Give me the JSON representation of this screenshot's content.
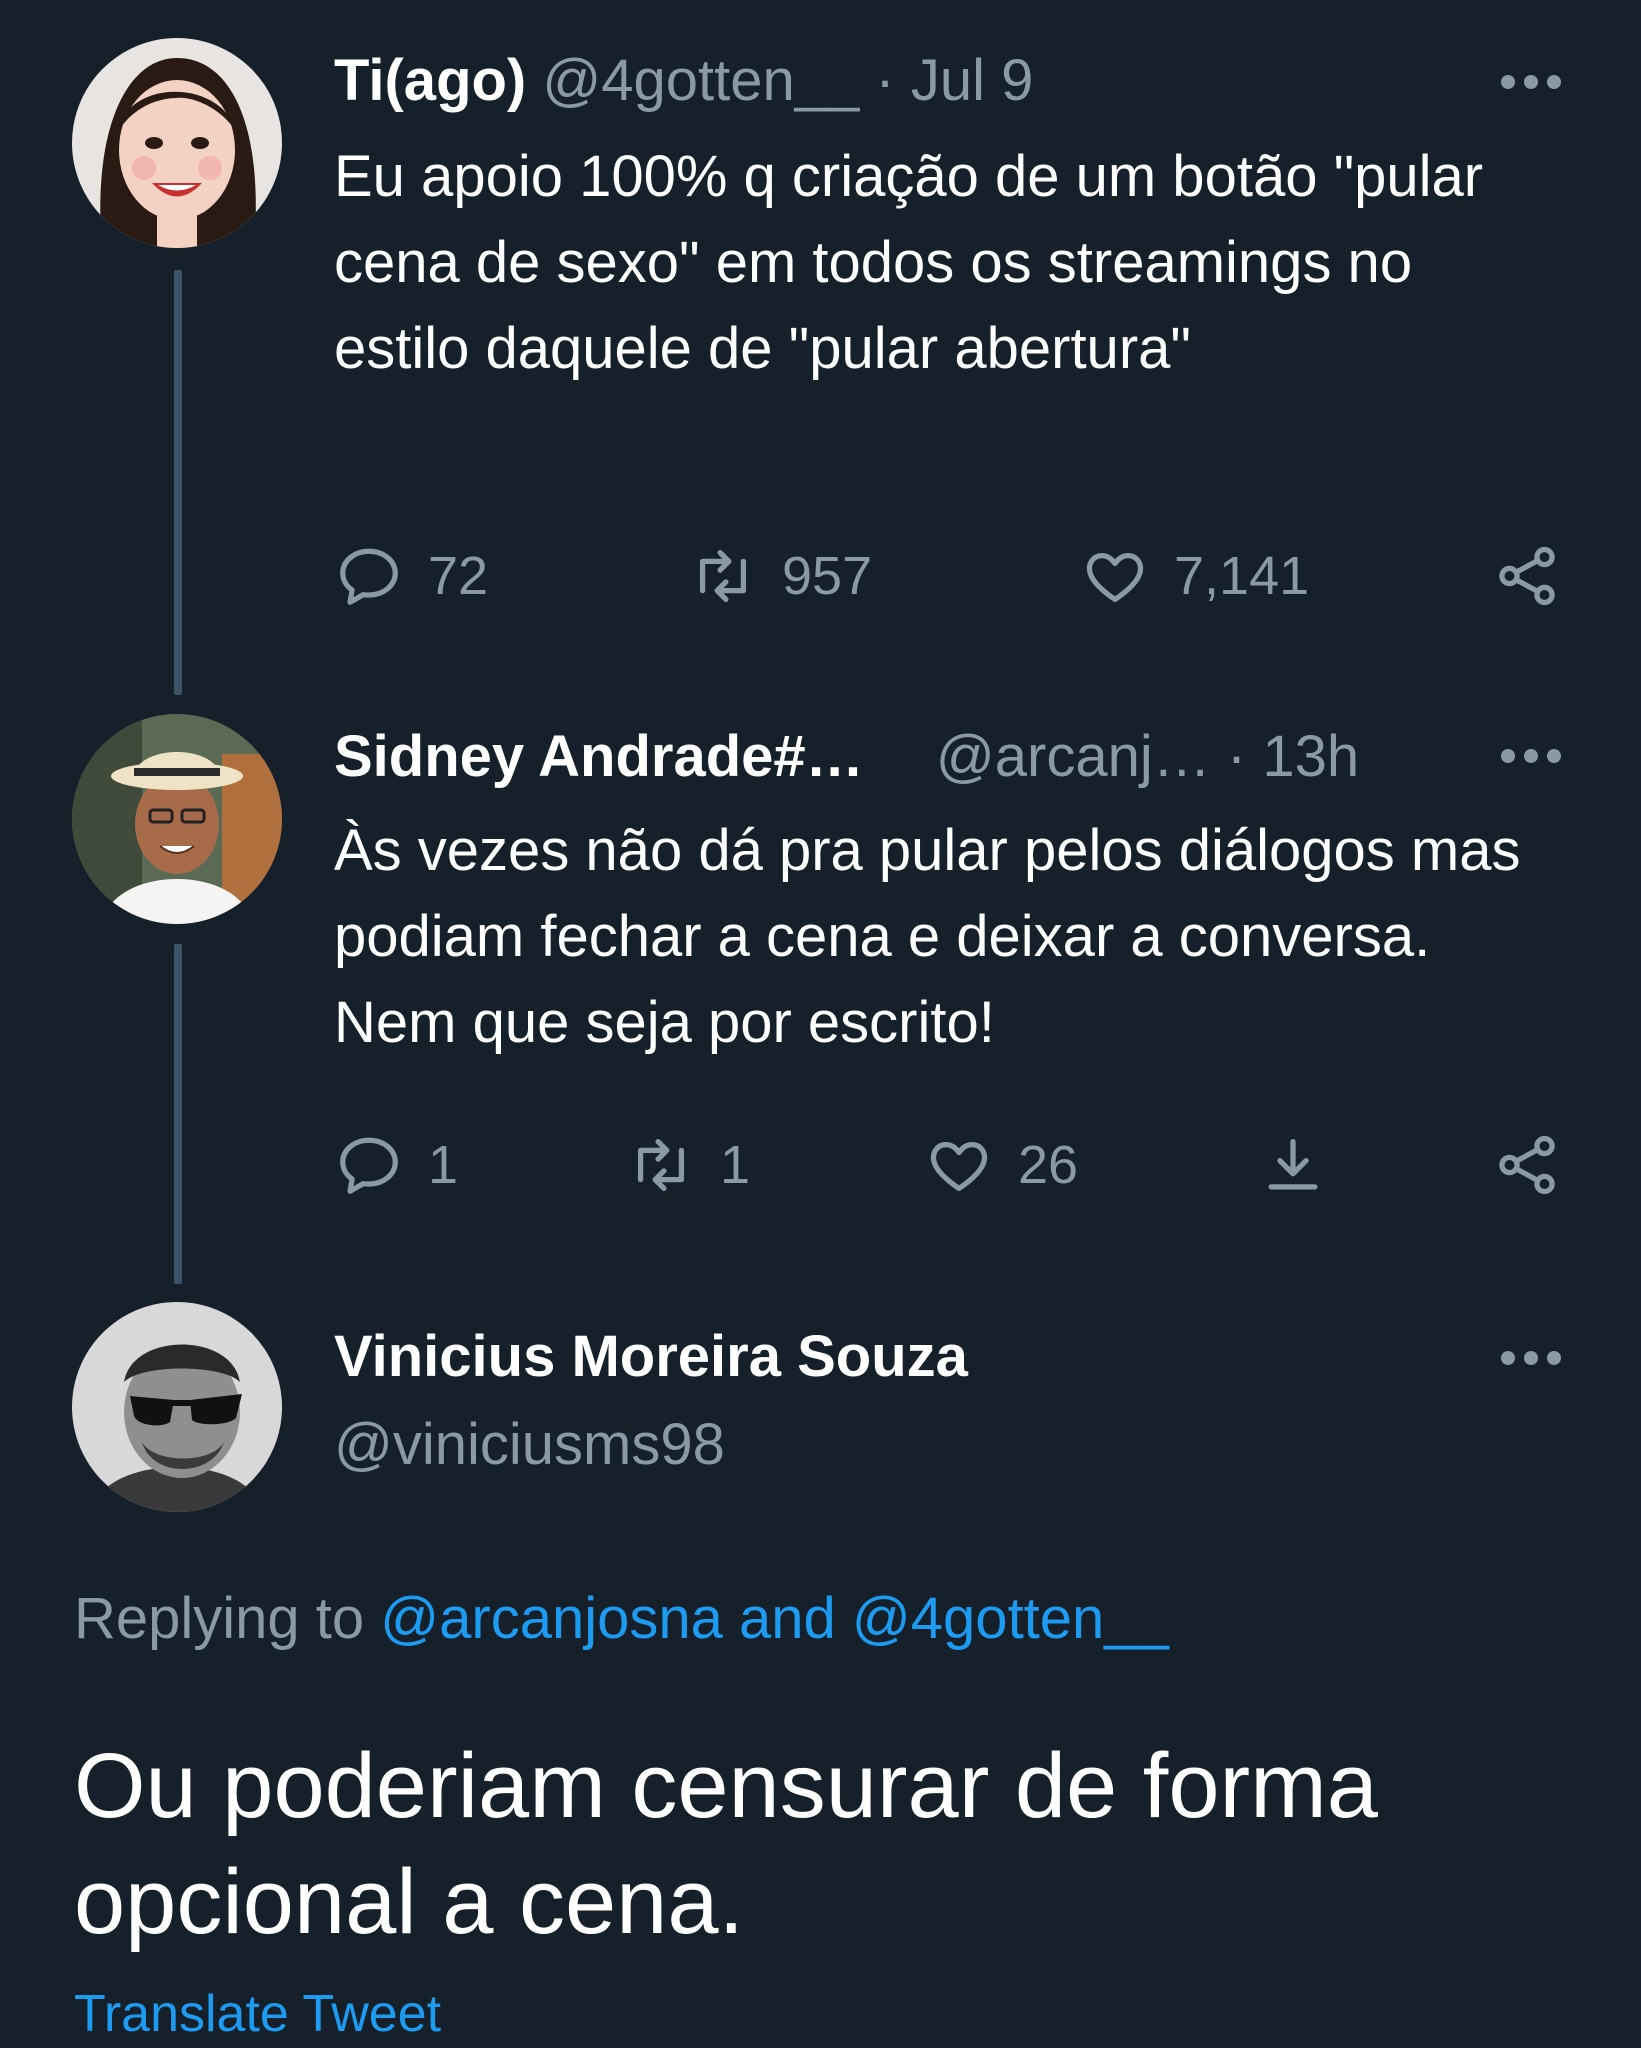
{
  "tweets": [
    {
      "name": "Ti(ago)",
      "handle": "@4gotten__",
      "time": "· Jul 9",
      "text": "Eu apoio 100% q criação de um botão \"pular cena de sexo\" em todos os streamings no estilo daquele de \"pular abertura\"",
      "replies": "72",
      "retweets": "957",
      "likes": "7,141"
    },
    {
      "name": "Sidney Andrade#…",
      "handle": "@arcanj…",
      "time": "· 13h",
      "text": "Às vezes não dá pra pular pelos diálogos mas podiam fechar a cena e deixar a conversa. Nem que seja por escrito!",
      "replies": "1",
      "retweets": "1",
      "likes": "26"
    }
  ],
  "main": {
    "name": "Vinicius Moreira Souza",
    "handle": "@viniciusms98",
    "replying_prefix": "Replying to",
    "replying_users": "@arcanjosna and @4gotten__",
    "text": "Ou poderiam censurar de forma opcional a cena.",
    "translate": "Translate Tweet"
  },
  "icons": [
    "reply-icon",
    "retweet-icon",
    "like-icon",
    "share-icon",
    "download-icon",
    "more-icon"
  ],
  "colors": {
    "background": "#15202b",
    "text": "#ffffff",
    "muted": "#8b98a5",
    "link": "#1d9bf0",
    "thread_line": "#3d5466"
  }
}
